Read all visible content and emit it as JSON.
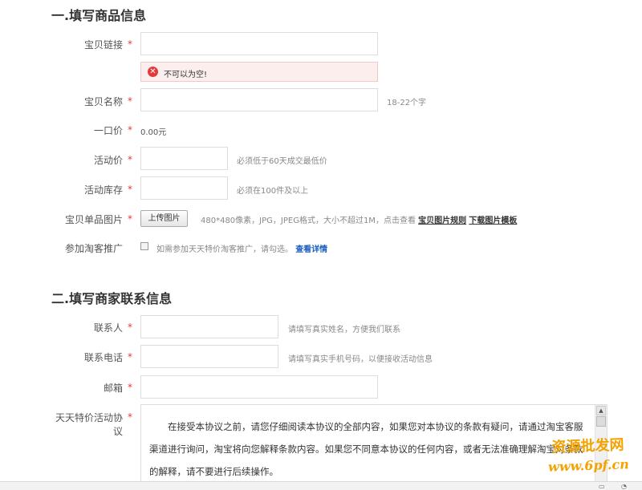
{
  "section1": {
    "title": "一.填写商品信息",
    "required_mark": "*",
    "link": {
      "label": "宝贝链接",
      "value": ""
    },
    "error": {
      "icon": "close-circle-icon",
      "text": "不可以为空!"
    },
    "name": {
      "label": "宝贝名称",
      "value": "",
      "hint": "18-22个字"
    },
    "price": {
      "label": "一口价",
      "value": "0.00元"
    },
    "activity_price": {
      "label": "活动价",
      "value": "",
      "hint": "必须低于60天成交最低价"
    },
    "stock": {
      "label": "活动库存",
      "value": "",
      "hint": "必须在100件及以上"
    },
    "image": {
      "label": "宝贝单品图片",
      "button": "上传图片",
      "hint": "480*480像素，JPG，JPEG格式，大小不超过1M，点击查看",
      "rule_link": "宝贝图片规则",
      "template_link": "下载图片模板"
    },
    "promo": {
      "label": "参加淘客推广",
      "checked": false,
      "hint": "如需参加天天特价淘客推广，请勾选。",
      "details_link": "查看详情"
    }
  },
  "section2": {
    "title": "二.填写商家联系信息",
    "contact": {
      "label": "联系人",
      "value": "",
      "hint": "请填写真实姓名，方便我们联系"
    },
    "phone": {
      "label": "联系电话",
      "value": "",
      "hint": "请填写真实手机号码，以便接收活动信息"
    },
    "email": {
      "label": "邮箱",
      "value": ""
    },
    "agreement": {
      "label": "天天特价活动协议",
      "text": "在接受本协议之前，请您仔细阅读本协议的全部内容，如果您对本协议的条款有疑问，请通过淘宝客服渠道进行询问，淘宝将向您解释条款内容。如果您不同意本协议的任何内容，或者无法准确理解淘宝对条款的解释，请不要进行后续操作。"
    }
  },
  "watermark": {
    "line1": "资源批发网",
    "line2": "www.6pf.cn"
  },
  "colors": {
    "required": "#e4393c",
    "link": "#1a5fc2",
    "error_bg": "#fdeeee",
    "watermark": "#f3a200"
  }
}
